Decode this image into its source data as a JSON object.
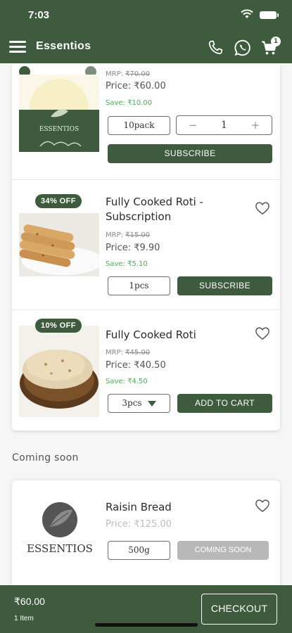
{
  "status_bar": {
    "time": "7:03"
  },
  "app_bar": {
    "title": "Essentios",
    "cart_count": "1"
  },
  "products": [
    {
      "brand_text": "ESSENTIOS",
      "mrp_label": "MRP: ",
      "mrp_value": "₹70.00",
      "price": "Price: ₹60.00",
      "save": "Save: ₹10.00",
      "pack": "10pack",
      "qty_minus": "−",
      "quantity": "1",
      "qty_plus": "+",
      "action": "SUBSCRIBE"
    },
    {
      "discount": "34% OFF",
      "name": "Fully Cooked Roti - Subscription",
      "mrp_label": "MRP: ",
      "mrp_value": "₹15.00",
      "price": "Price: ₹9.90",
      "save": "Save: ₹5.10",
      "pack": "1pcs",
      "action": "SUBSCRIBE"
    },
    {
      "discount": "10% OFF",
      "name": "Fully Cooked Roti",
      "mrp_label": "MRP: ",
      "mrp_value": "₹45.00",
      "price": "Price: ₹40.50",
      "save": "Save: ₹4.50",
      "pack": "3pcs",
      "action": "ADD TO CART"
    }
  ],
  "coming_soon": {
    "title": "Coming soon",
    "product": {
      "logo_text": "ESSENTIOS",
      "name": "Raisin Bread",
      "price": "Price: ₹125.00",
      "pack": "500g",
      "action": "COMING SOON"
    }
  },
  "cart_summary": {
    "total": "₹60.00",
    "items": "1 Item",
    "checkout": "CHECKOUT"
  },
  "colors": {
    "primary": "#3e5b3e",
    "save_green": "#4caf50",
    "disabled": "#b8b8b8"
  }
}
